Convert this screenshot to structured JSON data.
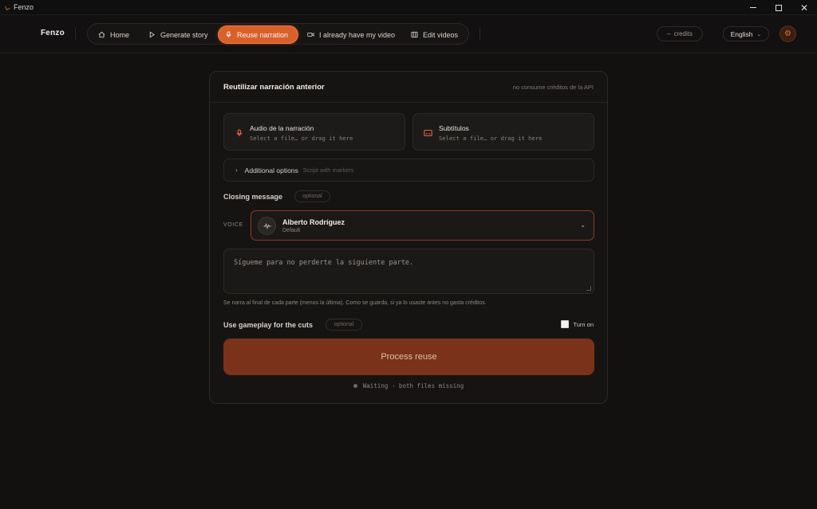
{
  "window": {
    "title": "Fenzo"
  },
  "header": {
    "brand": "Fenzo",
    "nav": [
      {
        "label": "Home",
        "icon": "home-icon"
      },
      {
        "label": "Generate story",
        "icon": "play-icon"
      },
      {
        "label": "Reuse narration",
        "icon": "mic-icon",
        "active": true
      },
      {
        "label": "I already have my video",
        "icon": "video-icon"
      },
      {
        "label": "Edit videos",
        "icon": "film-icon"
      }
    ],
    "credits": {
      "value": "–",
      "label": "credits"
    },
    "language": "English"
  },
  "card": {
    "title": "Reutilizar narración anterior",
    "note": "no consume créditos de la API",
    "audio": {
      "label": "Audio de la narración",
      "hint": "Select a file… or drag it here"
    },
    "subtitles": {
      "label": "Subtítulos",
      "hint": "Select a file… or drag it here"
    },
    "options": {
      "label": "Additional options",
      "hint": "Script with markers"
    },
    "closing": {
      "label": "Closing message",
      "badge": "optional",
      "voice_label": "VOICE",
      "voice_name": "Alberto Rodríguez",
      "voice_sub": "Default",
      "message": "Sígueme para no perderte la siguiente parte.",
      "helper": "Se narra al final de cada parte (menos la última). Como se guarda, si ya lo usaste antes no gasta créditos."
    },
    "gameplay": {
      "label": "Use gameplay for the cuts",
      "badge": "optional",
      "toggle_label": "Turn on",
      "checked": false
    },
    "action": {
      "label": "Process reuse"
    },
    "status": "Waiting · both files missing"
  },
  "colors": {
    "accent": "#d9602b",
    "button": "#7a321a",
    "background": "#131110"
  }
}
